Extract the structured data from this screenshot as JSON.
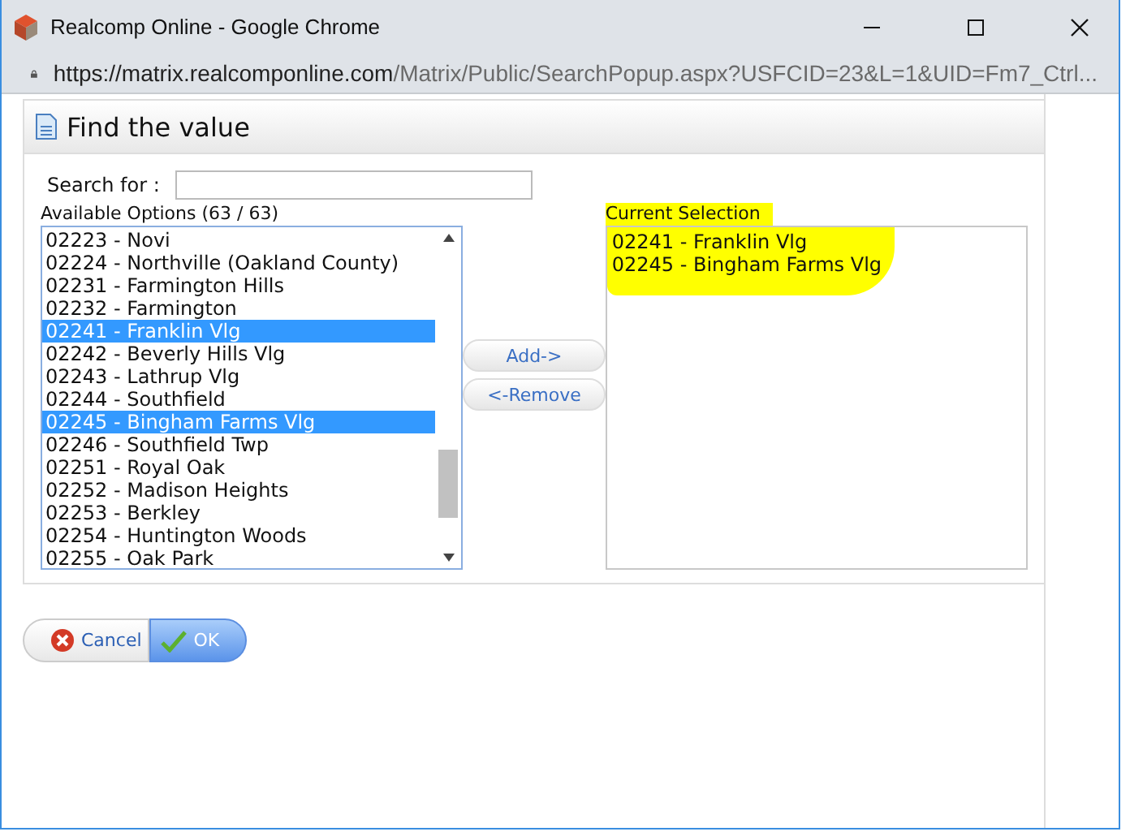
{
  "window": {
    "title": "Realcomp Online - Google Chrome"
  },
  "address_bar": {
    "host": "https://matrix.realcomponline.com",
    "path": "/Matrix/Public/SearchPopup.aspx?USFCID=23&L=1&UID=Fm7_Ctrl..."
  },
  "dialog": {
    "title": "Find the value",
    "search": {
      "label": "Search for :"
    },
    "available": {
      "label": "Available Options (63 / 63)",
      "options": [
        {
          "text": "02223 - Novi",
          "selected": false
        },
        {
          "text": "02224 - Northville (Oakland County)",
          "selected": false
        },
        {
          "text": "02231 - Farmington Hills",
          "selected": false
        },
        {
          "text": "02232 - Farmington",
          "selected": false
        },
        {
          "text": "02241 - Franklin Vlg",
          "selected": true
        },
        {
          "text": "02242 - Beverly Hills Vlg",
          "selected": false
        },
        {
          "text": "02243 - Lathrup Vlg",
          "selected": false
        },
        {
          "text": "02244 - Southfield",
          "selected": false
        },
        {
          "text": "02245 - Bingham Farms Vlg",
          "selected": true
        },
        {
          "text": "02246 - Southfield Twp",
          "selected": false
        },
        {
          "text": "02251 - Royal Oak",
          "selected": false
        },
        {
          "text": "02252 - Madison Heights",
          "selected": false
        },
        {
          "text": "02253 - Berkley",
          "selected": false
        },
        {
          "text": "02254 - Huntington Woods",
          "selected": false
        },
        {
          "text": "02255 - Oak Park",
          "selected": false
        }
      ]
    },
    "move_buttons": [
      "Add->",
      "<-Remove"
    ],
    "current": {
      "label": "Current Selection",
      "items": [
        "02241 - Franklin Vlg",
        "02245 - Bingham Farms Vlg"
      ]
    },
    "buttons": {
      "cancel": "Cancel",
      "ok": "OK"
    }
  }
}
